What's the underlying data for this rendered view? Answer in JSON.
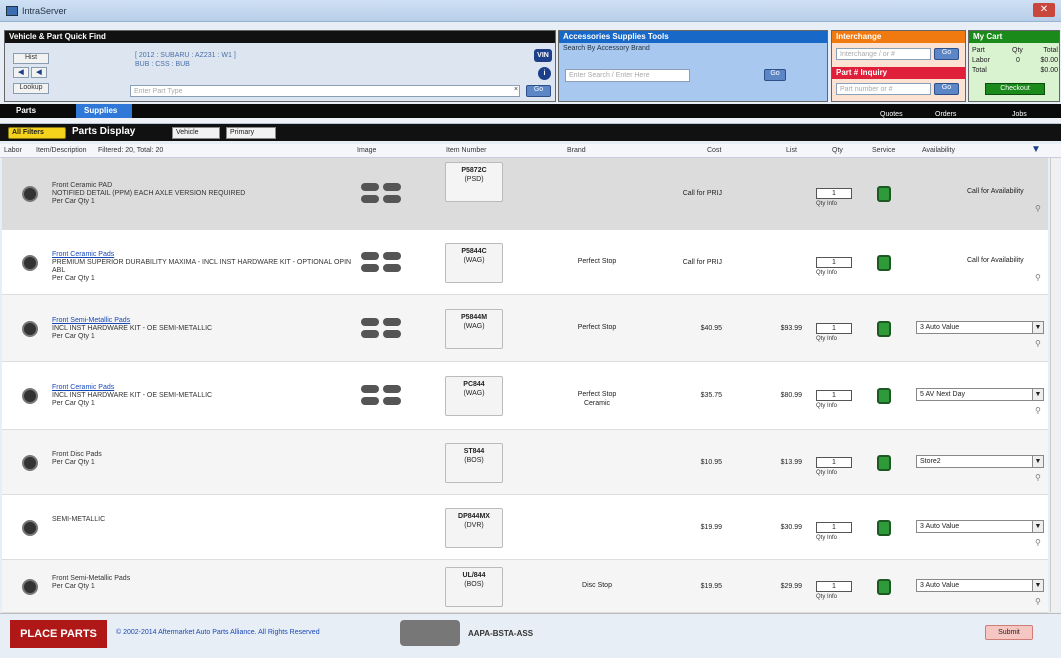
{
  "window": {
    "title": "IntraServer"
  },
  "vehicle_panel": {
    "title": "Vehicle & Part Quick Find",
    "vehicle_text_line1": "[ 2012 : SUBARU : AZ231 : W1 ]",
    "vehicle_text_line2": "BUB : CSS : BUB",
    "part_type_placeholder": "Enter Part Type",
    "btn_hist": "Hist",
    "btn_lookup": "Lookup",
    "vin_label": "VIN",
    "go_label": "Go"
  },
  "accessories_panel": {
    "title": "Accessories Supplies Tools",
    "subtitle": "Search By Accessory Brand",
    "search_placeholder": "Enter Search / Enter Here",
    "go_label": "Go"
  },
  "interchange_panel": {
    "title": "Interchange",
    "placeholder": "Interchange / or #",
    "go_label": "Go"
  },
  "partnum_panel": {
    "title": "Part # Inquiry",
    "placeholder": "Part number or #",
    "go_label": "Go"
  },
  "cart_panel": {
    "title": "My Cart",
    "rows": [
      {
        "label": "Part",
        "qty": "Qty",
        "total": "Total"
      },
      {
        "label": "Labor",
        "qty": "0",
        "total": "$0.00"
      },
      {
        "label": "Total",
        "qty": "",
        "total": "$0.00"
      }
    ],
    "checkout_label": "Checkout"
  },
  "tabs": {
    "parts": "Parts",
    "supplies": "Supplies"
  },
  "subbar": {
    "quotes": "Quotes",
    "orders": "Orders",
    "jobs": "Jobs"
  },
  "display": {
    "filters_label": "All Filters",
    "title": "Parts Display",
    "view_option": "Vehicle",
    "sort_option": "Primary"
  },
  "columns": {
    "labor": "Labor",
    "item_desc": "Item/Description",
    "filtered": "Filtered: 20,  Total: 20",
    "image": "Image",
    "item_number": "Item Number",
    "brand": "Brand",
    "cost": "Cost",
    "list": "List",
    "qty": "Qty",
    "service": "Service",
    "availability": "Availability"
  },
  "rows": [
    {
      "name": "Front Ceramic PAD",
      "detail": "NOTIFIED DETAIL (PPM) EACH AXLE VERSION REQUIRED",
      "per": "Per Car Qty 1",
      "item": "P5872C",
      "loc": "(PSD)",
      "brand": "",
      "brand2": "",
      "cost": "Call for PRIJ",
      "list": "",
      "qty": "1",
      "avail": "Call for Availability",
      "has_select": false
    },
    {
      "name": "Front Ceramic Pads",
      "detail": "PREMIUM SUPERIOR DURABILITY MAXIMA - INCL INST HARDWARE KIT - OPTIONAL OPIN ABL",
      "per": "Per Car Qty 1",
      "item": "P5844C",
      "loc": "(WAG)",
      "brand": "Perfect Stop",
      "brand2": "",
      "cost": "Call for PRIJ",
      "list": "",
      "qty": "1",
      "avail": "Call for Availability",
      "has_select": false
    },
    {
      "name": "Front Semi-Metallic Pads",
      "detail": "INCL INST HARDWARE KIT - OE SEMI-METALLIC",
      "per": "Per Car Qty 1",
      "item": "P5844M",
      "loc": "(WAG)",
      "brand": "Perfect Stop",
      "brand2": "",
      "cost": "$40.95",
      "list": "$93.99",
      "qty": "1",
      "avail": "3 Auto Value",
      "has_select": true
    },
    {
      "name": "Front Ceramic Pads",
      "detail": "INCL INST HARDWARE KIT - OE SEMI-METALLIC",
      "per": "Per Car Qty 1",
      "item": "PC844",
      "loc": "(WAG)",
      "brand": "Perfect Stop",
      "brand2": "Ceramic",
      "cost": "$35.75",
      "list": "$80.99",
      "qty": "1",
      "avail": "5 AV Next Day",
      "has_select": true
    },
    {
      "name": "Front Disc Pads",
      "detail": "",
      "per": "Per Car Qty 1",
      "item": "ST844",
      "loc": "(BOS)",
      "brand": "",
      "brand2": "",
      "cost": "$10.95",
      "list": "$13.99",
      "qty": "1",
      "avail": "Store2",
      "has_select": true
    },
    {
      "name": "SEMI-METALLIC",
      "detail": "",
      "per": "",
      "item": "DP844MX",
      "loc": "(DVR)",
      "brand": "",
      "brand2": "",
      "cost": "$19.99",
      "list": "$30.99",
      "qty": "1",
      "avail": "3 Auto Value",
      "has_select": true
    },
    {
      "name": "Front Semi-Metallic Pads",
      "detail": "",
      "per": "Per Car Qty 1",
      "item": "UL/844",
      "loc": "(BOS)",
      "brand": "Disc Stop",
      "brand2": "",
      "cost": "$19.95",
      "list": "$29.99",
      "qty": "1",
      "avail": "3 Auto Value",
      "has_select": true
    }
  ],
  "footer": {
    "logo": "PLACE PARTS",
    "copyright": "© 2002-2014 Aftermarket Auto Parts Alliance. All Rights Reserved",
    "aapia": "AAPA-BSTA-ASS",
    "submit_label": "Submit"
  },
  "qty_info": "Qty Info",
  "colors": {
    "accent_blue": "#1868c8",
    "green_service": "#2e9a3a",
    "cart_green": "#1a8a1a",
    "orange": "#f07a10",
    "red": "#e0203a"
  }
}
